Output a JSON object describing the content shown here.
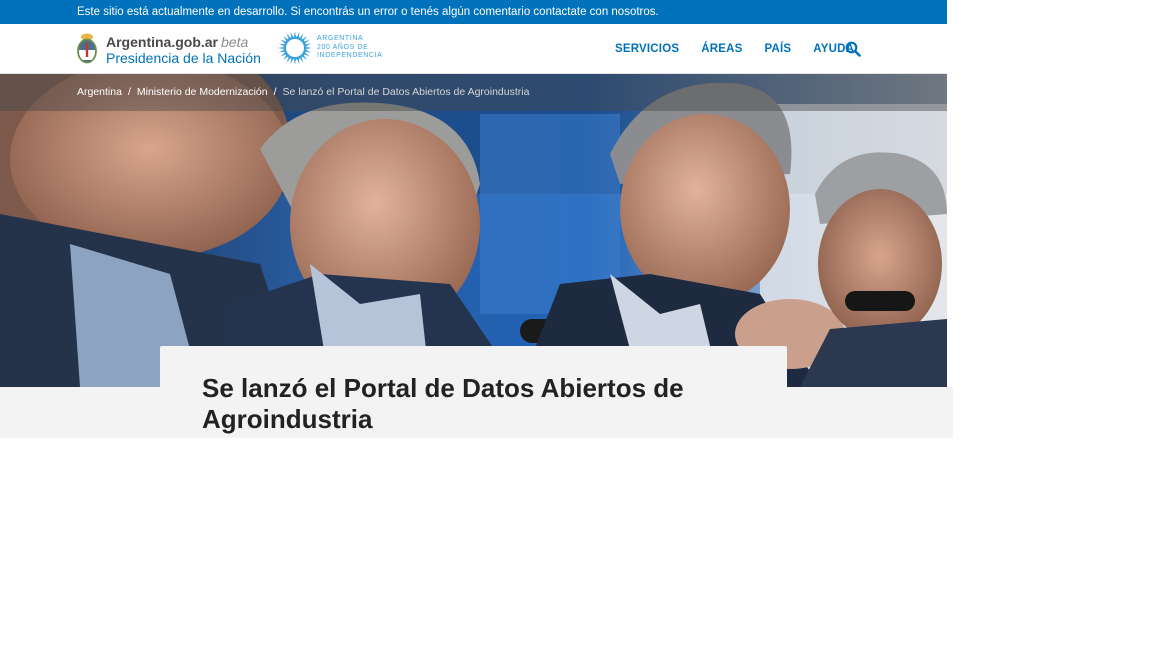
{
  "devbar": {
    "text": "Este sitio está actualmente en desarrollo. Si encontrás un error o tenés algún comentario contactate con nosotros."
  },
  "header": {
    "brand": "Argentina.gob.ar",
    "beta": "beta",
    "presidencia": "Presidencia de la Nación",
    "bicentenario": [
      "ARGENTINA",
      "200 AÑOS DE",
      "INDEPENDENCIA"
    ]
  },
  "nav": {
    "items": [
      "SERVICIOS",
      "ÁREAS",
      "PAÍS",
      "AYUDA"
    ]
  },
  "icons": {
    "search": "search-icon",
    "shield": "coat-of-arms-icon",
    "bicentennial": "bicentennial-sun-icon"
  },
  "breadcrumb": {
    "items": [
      "Argentina",
      "Ministerio de Modernización",
      "Se lanzó el Portal de Datos Abiertos de Agroindustria"
    ],
    "separator": "/"
  },
  "article": {
    "title": "Se lanzó el Portal de Datos Abiertos de Agroindustria"
  },
  "colors": {
    "primary": "#0072bb",
    "devbar": "#0072bb",
    "bicentenario": "#39a3e0",
    "panel": "#f3f3f3"
  }
}
